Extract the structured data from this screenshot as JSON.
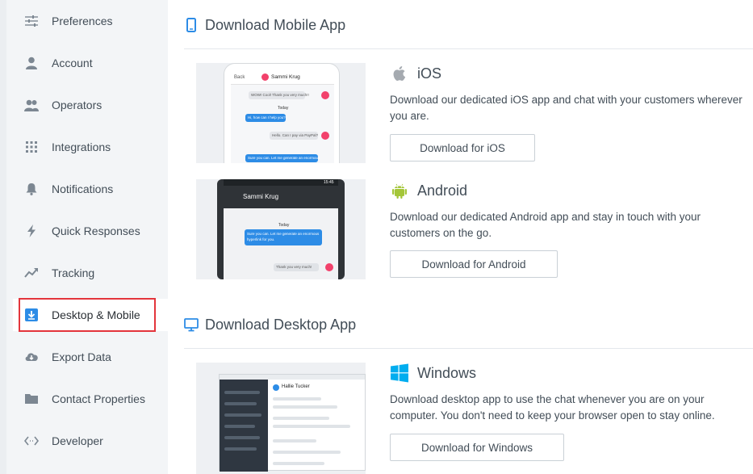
{
  "sidebar": {
    "items": [
      {
        "label": "Preferences",
        "icon": "sliders-icon"
      },
      {
        "label": "Account",
        "icon": "user-icon"
      },
      {
        "label": "Operators",
        "icon": "users-icon"
      },
      {
        "label": "Integrations",
        "icon": "grid-icon"
      },
      {
        "label": "Notifications",
        "icon": "bell-icon"
      },
      {
        "label": "Quick Responses",
        "icon": "bolt-icon"
      },
      {
        "label": "Tracking",
        "icon": "trend-icon"
      },
      {
        "label": "Desktop & Mobile",
        "icon": "download-box-icon",
        "active": true
      },
      {
        "label": "Export Data",
        "icon": "cloud-download-icon"
      },
      {
        "label": "Contact Properties",
        "icon": "folder-icon"
      },
      {
        "label": "Developer",
        "icon": "code-icon"
      }
    ]
  },
  "mobile": {
    "title": "Download Mobile App",
    "ios": {
      "name": "iOS",
      "description": "Download our dedicated iOS app and chat with your customers wherever you are.",
      "button": "Download for iOS",
      "shot": {
        "back": "Back",
        "contact": "Sammi Krug",
        "msg1": "WOW! Cool! Thank you very much!!",
        "day": "Today",
        "msg2": "Hi, how can I help you?",
        "msg3": "Hello. Can I pay via PayPal?",
        "msg4": "Sure you can. Let me generate an enormous"
      }
    },
    "android": {
      "name": "Android",
      "description": "Download our dedicated Android app and stay in touch with your customers on the go.",
      "button": "Download for Android",
      "shot": {
        "contact": "Sammi Krug",
        "time": "15:45",
        "day": "Today",
        "msg1": "Sure you can. Let me generate an enormous hyperlink for you.",
        "msg2": "Thank you very much!"
      }
    }
  },
  "desktop": {
    "title": "Download Desktop App",
    "windows": {
      "name": "Windows",
      "description": "Download desktop app to use the chat whenever you are on your computer. You don't need to keep your browser open to stay online.",
      "button": "Download for Windows",
      "shot": {
        "contact": "Hallie Tucker"
      }
    }
  },
  "colors": {
    "accent": "#2d8ce6",
    "android": "#a4c639",
    "windows": "#00adef",
    "highlight": "#e3353c",
    "ios_dot": "#f2416b"
  }
}
